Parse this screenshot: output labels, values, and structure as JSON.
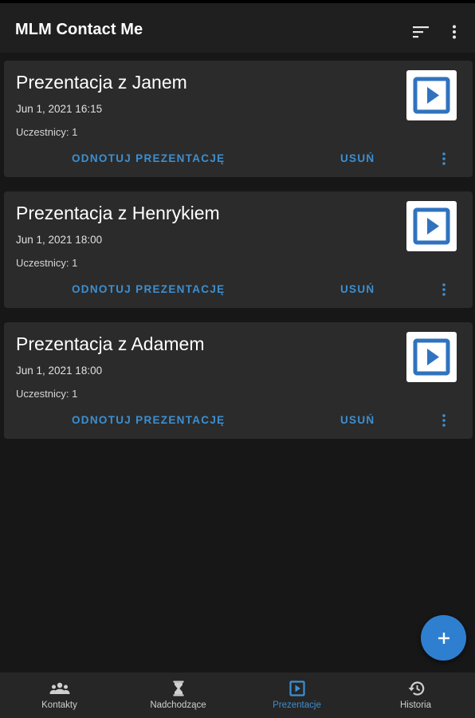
{
  "app": {
    "title": "MLM Contact Me"
  },
  "toolbar": {
    "sort_icon": "sort-icon",
    "more_icon": "more-vert-icon"
  },
  "colors": {
    "accent": "#3d8fd1",
    "fab": "#2f7fd0",
    "card_bg": "#2b2b2b",
    "screen_bg": "#171717",
    "appbar_bg": "#1f1f1f",
    "nav_bg": "#262626"
  },
  "presentations": [
    {
      "title": "Prezentacja z Janem",
      "date": "Jun 1, 2021 16:15",
      "participants": "Uczestnicy: 1",
      "note_action": "ODNOTUJ PREZENTACJĘ",
      "delete_action": "USUŃ"
    },
    {
      "title": "Prezentacja z Henrykiem",
      "date": "Jun 1, 2021 18:00",
      "participants": "Uczestnicy: 1",
      "note_action": "ODNOTUJ PREZENTACJĘ",
      "delete_action": "USUŃ"
    },
    {
      "title": "Prezentacja z Adamem",
      "date": "Jun 1, 2021 18:00",
      "participants": "Uczestnicy: 1",
      "note_action": "ODNOTUJ PREZENTACJĘ",
      "delete_action": "USUŃ"
    }
  ],
  "fab": {
    "icon": "plus-icon"
  },
  "bottom_nav": {
    "items": [
      {
        "label": "Kontakty",
        "icon": "people-icon",
        "active": false
      },
      {
        "label": "Nadchodzące",
        "icon": "hourglass-icon",
        "active": false
      },
      {
        "label": "Prezentacje",
        "icon": "play-box-icon",
        "active": true
      },
      {
        "label": "Historia",
        "icon": "history-icon",
        "active": false
      }
    ]
  }
}
